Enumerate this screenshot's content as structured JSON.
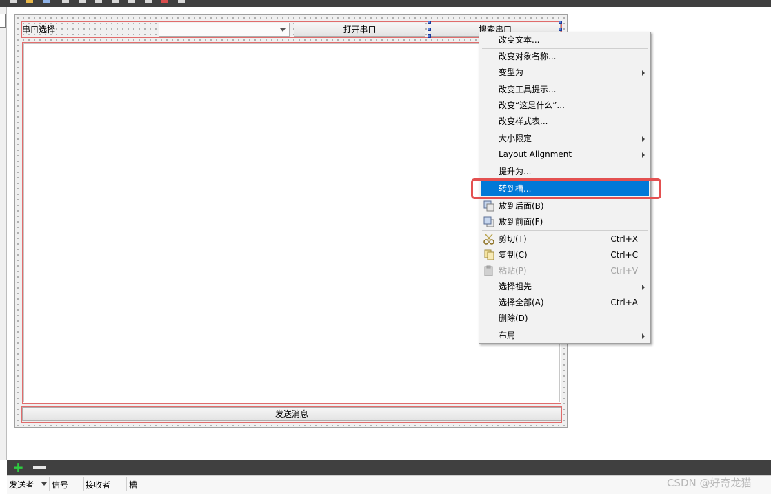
{
  "form": {
    "port_label": "串口选择",
    "port_combo_value": "",
    "open_port_button": "打开串口",
    "search_port_button": "搜索串口",
    "send_button": "发送消息"
  },
  "context_menu": {
    "items": [
      {
        "label": "改变文本...",
        "shortcut": "",
        "submenu": false
      },
      {
        "label": "改变对象名称...",
        "shortcut": "",
        "submenu": false
      },
      {
        "label": "变型为",
        "shortcut": "",
        "submenu": true
      },
      {
        "label": "改变工具提示...",
        "shortcut": "",
        "submenu": false
      },
      {
        "label": "改变“这是什么”...",
        "shortcut": "",
        "submenu": false
      },
      {
        "label": "改变样式表...",
        "shortcut": "",
        "submenu": false
      },
      {
        "label": "大小限定",
        "shortcut": "",
        "submenu": true
      },
      {
        "label": "Layout Alignment",
        "shortcut": "",
        "submenu": true
      },
      {
        "label": "提升为...",
        "shortcut": "",
        "submenu": false
      },
      {
        "label": "转到槽...",
        "shortcut": "",
        "submenu": false,
        "state": "highlighted"
      },
      {
        "label": "放到后面(B)",
        "shortcut": "",
        "submenu": false,
        "icon": "send-to-back-icon"
      },
      {
        "label": "放到前面(F)",
        "shortcut": "",
        "submenu": false,
        "icon": "bring-to-front-icon"
      },
      {
        "label": "剪切(T)",
        "shortcut": "Ctrl+X",
        "submenu": false,
        "icon": "scissors-icon"
      },
      {
        "label": "复制(C)",
        "shortcut": "Ctrl+C",
        "submenu": false,
        "icon": "copy-icon"
      },
      {
        "label": "粘贴(P)",
        "shortcut": "Ctrl+V",
        "submenu": false,
        "icon": "paste-icon",
        "state": "disabled"
      },
      {
        "label": "选择祖先",
        "shortcut": "",
        "submenu": true
      },
      {
        "label": "选择全部(A)",
        "shortcut": "Ctrl+A",
        "submenu": false
      },
      {
        "label": "删除(D)",
        "shortcut": "",
        "submenu": false
      },
      {
        "label": "布局",
        "shortcut": "",
        "submenu": true
      }
    ]
  },
  "signal_slot_panel": {
    "columns": [
      "发送者",
      "信号",
      "接收者",
      "槽"
    ]
  },
  "watermark": "CSDN @好奇龙猫",
  "colors": {
    "selection": "#0078d7",
    "highlight_box": "#e35050",
    "layout_border": "#e06c6c"
  }
}
